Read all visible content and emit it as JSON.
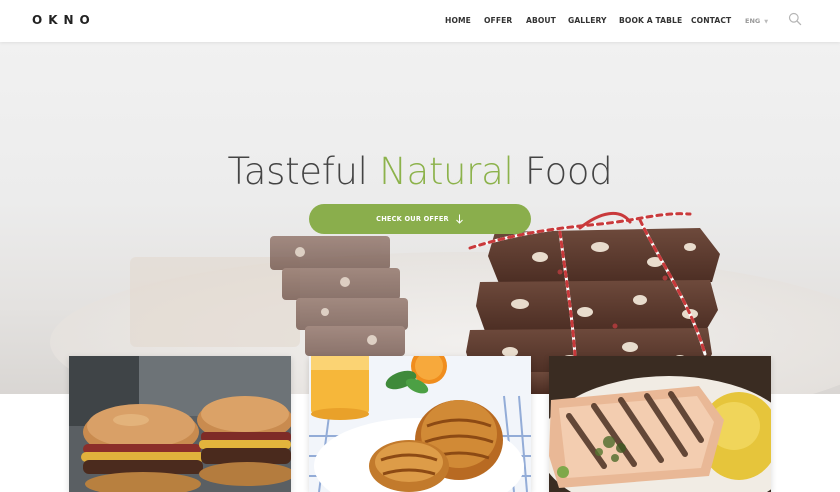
{
  "brand": {
    "logo": "OKNO"
  },
  "nav": {
    "items": [
      {
        "label": "HOME"
      },
      {
        "label": "OFFER"
      },
      {
        "label": "ABOUT"
      },
      {
        "label": "GALLERY"
      },
      {
        "label": "BOOK A TABLE"
      },
      {
        "label": "CONTACT"
      }
    ],
    "language": "ENG"
  },
  "hero": {
    "title_part1": "Tasteful",
    "title_accent": "Natural",
    "title_part3": "Food",
    "cta_label": "CHECK OUR OFFER"
  },
  "colors": {
    "accent": "#8cb24b",
    "button": "#8aae4c",
    "text_dark": "#333333"
  },
  "cards": [
    {
      "subject": "burgers"
    },
    {
      "subject": "croissants-and-orange-juice"
    },
    {
      "subject": "grilled-fish-with-rice"
    }
  ]
}
